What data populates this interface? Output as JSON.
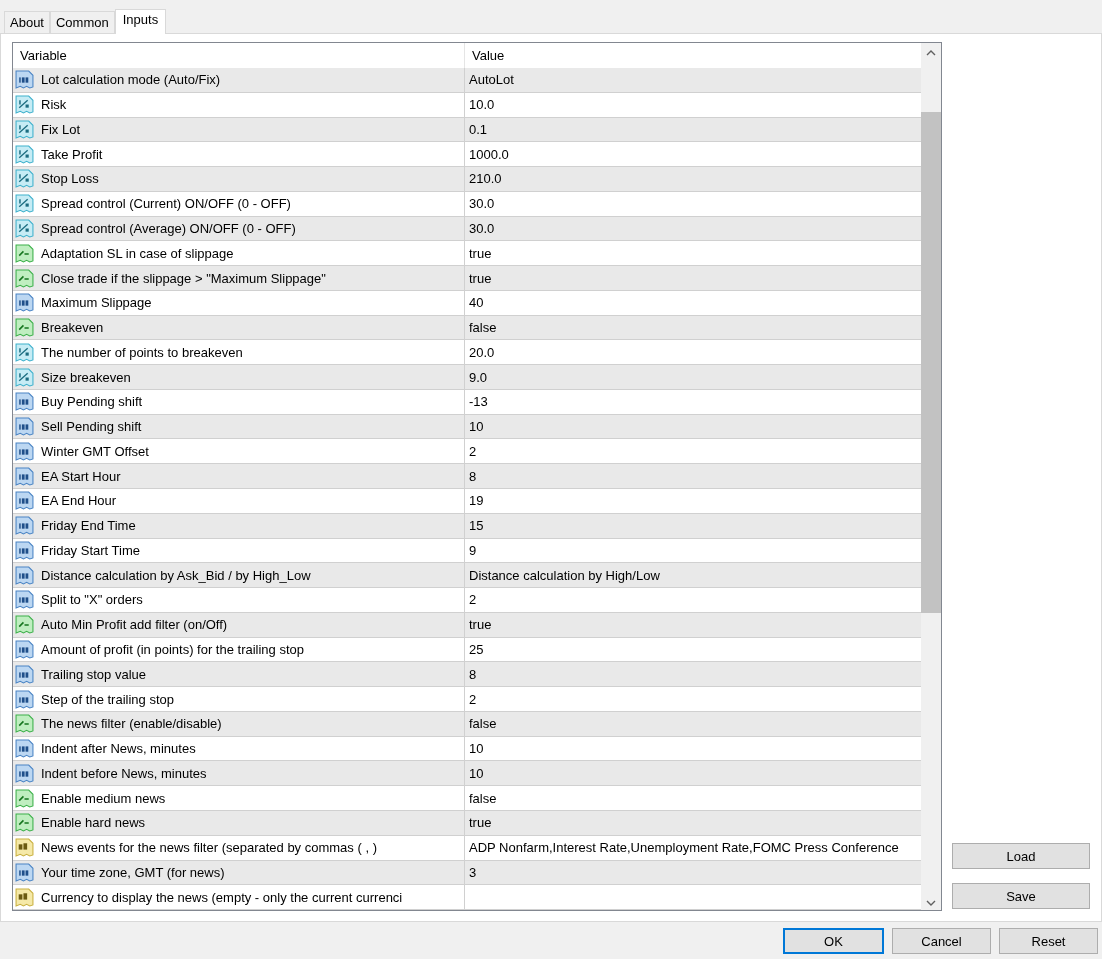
{
  "tabs": [
    {
      "label": "About",
      "selected": false
    },
    {
      "label": "Common",
      "selected": false
    },
    {
      "label": "Inputs",
      "selected": true
    }
  ],
  "table": {
    "columns": [
      "Variable",
      "Value"
    ],
    "rows": [
      {
        "kind": "int",
        "variable": "Lot calculation mode (Auto/Fix)",
        "value": "AutoLot"
      },
      {
        "kind": "double",
        "variable": "Risk",
        "value": "10.0"
      },
      {
        "kind": "double",
        "variable": "Fix Lot",
        "value": "0.1"
      },
      {
        "kind": "double",
        "variable": "Take Profit",
        "value": "1000.0"
      },
      {
        "kind": "double",
        "variable": "Stop Loss",
        "value": "210.0"
      },
      {
        "kind": "double",
        "variable": "Spread control (Current) ON/OFF (0 - OFF)",
        "value": "30.0"
      },
      {
        "kind": "double",
        "variable": "Spread control (Average) ON/OFF (0 - OFF)",
        "value": "30.0"
      },
      {
        "kind": "bool",
        "variable": "Adaptation SL in case of slippage",
        "value": "true"
      },
      {
        "kind": "bool",
        "variable": "Close trade if the slippage > \"Maximum Slippage\"",
        "value": "true"
      },
      {
        "kind": "int",
        "variable": "Maximum Slippage",
        "value": "40"
      },
      {
        "kind": "bool",
        "variable": "Breakeven",
        "value": "false"
      },
      {
        "kind": "double",
        "variable": "The number of points to breakeven",
        "value": "20.0"
      },
      {
        "kind": "double",
        "variable": "Size breakeven",
        "value": "9.0"
      },
      {
        "kind": "int",
        "variable": "Buy Pending shift",
        "value": "-13"
      },
      {
        "kind": "int",
        "variable": "Sell Pending shift",
        "value": "10"
      },
      {
        "kind": "int",
        "variable": "Winter GMT Offset",
        "value": "2"
      },
      {
        "kind": "int",
        "variable": "EA Start Hour",
        "value": "8"
      },
      {
        "kind": "int",
        "variable": "EA End Hour",
        "value": "19"
      },
      {
        "kind": "int",
        "variable": "Friday End Time",
        "value": "15"
      },
      {
        "kind": "int",
        "variable": "Friday Start Time",
        "value": "9"
      },
      {
        "kind": "int",
        "variable": "Distance calculation by Ask_Bid / by High_Low",
        "value": "Distance calculation by High/Low"
      },
      {
        "kind": "int",
        "variable": "Split to \"X\" orders",
        "value": "2"
      },
      {
        "kind": "bool",
        "variable": "Auto Min Profit add filter (on/Off)",
        "value": "true"
      },
      {
        "kind": "int",
        "variable": "Amount of profit (in points) for the trailing stop",
        "value": "25"
      },
      {
        "kind": "int",
        "variable": "Trailing stop value",
        "value": "8"
      },
      {
        "kind": "int",
        "variable": "Step of the trailing stop",
        "value": "2"
      },
      {
        "kind": "bool",
        "variable": "The news filter (enable/disable)",
        "value": "false"
      },
      {
        "kind": "int",
        "variable": "Indent after News, minutes",
        "value": "10"
      },
      {
        "kind": "int",
        "variable": "Indent before News, minutes",
        "value": "10"
      },
      {
        "kind": "bool",
        "variable": "Enable medium news",
        "value": "false"
      },
      {
        "kind": "bool",
        "variable": "Enable hard news",
        "value": "true"
      },
      {
        "kind": "string",
        "variable": "News events for the news filter (separated by commas ( , )",
        "value": "ADP Nonfarm,Interest Rate,Unemployment Rate,FOMC Press Conference"
      },
      {
        "kind": "int",
        "variable": "Your time zone, GMT (for news)",
        "value": "3"
      },
      {
        "kind": "string",
        "variable": "Currency to display the news (empty - only the current currenci"
      }
    ]
  },
  "side_buttons": [
    "Load",
    "Save"
  ],
  "buttons": [
    {
      "label": "OK",
      "default": true
    },
    {
      "label": "Cancel",
      "default": false
    },
    {
      "label": "Reset",
      "default": false
    }
  ]
}
